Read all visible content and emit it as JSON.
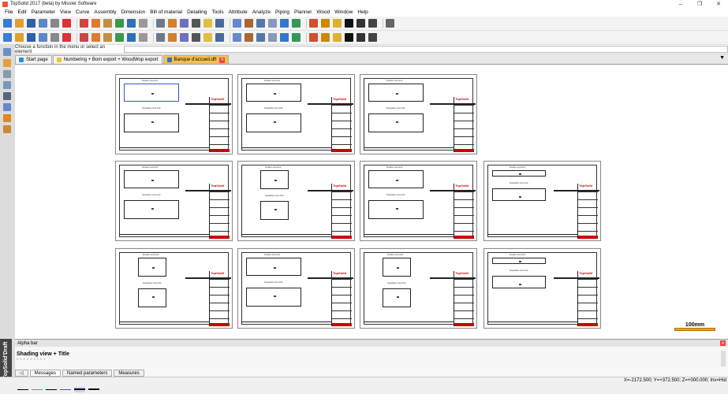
{
  "window": {
    "title": "TopSolid 2017 (beta) by Missler Software",
    "controls": [
      "–",
      "❐",
      "✕"
    ]
  },
  "menu": [
    "File",
    "Edit",
    "Parameter",
    "View",
    "Curve",
    "Assembly",
    "Dimension",
    "Bill of material",
    "Detailing",
    "Tools",
    "Attribute",
    "Analyze",
    "Piping",
    "Planner",
    "Wood",
    "Window",
    "Help"
  ],
  "toolbar1_icons": [
    "new-icon",
    "open-icon",
    "save-icon",
    "properties-icon",
    "print-icon",
    "delete-icon",
    "cut-icon",
    "erase-icon",
    "paint-icon",
    "import-icon",
    "export-icon",
    "document-icon",
    "settings-icon",
    "tool-icon",
    "measure-icon",
    "arc-icon",
    "pin-icon",
    "cursor-icon",
    "select-icon",
    "link-icon",
    "move-icon",
    "copy-icon",
    "zoom-icon",
    "fit-icon",
    "image-icon",
    "palette-icon",
    "calculator-icon",
    "color-icon",
    "dot-icon",
    "line-icon",
    "hatch-icon"
  ],
  "toolbar2_icons": [
    "view1-icon",
    "view2-icon",
    "view3-icon",
    "view4-icon",
    "view5-icon",
    "view6-icon",
    "view7-icon",
    "view8-icon",
    "view9-icon",
    "view10-icon",
    "view11-icon",
    "view12-icon",
    "view13-icon",
    "view14-icon",
    "view15-icon",
    "view16-icon",
    "view17-icon",
    "view18-icon",
    "view19-icon",
    "view20-icon",
    "view21-icon",
    "view22-icon",
    "view23-icon",
    "view24-icon",
    "view25-icon",
    "view26-icon",
    "view27-icon",
    "view28-icon",
    "view29-icon",
    "view30-icon"
  ],
  "prompt": {
    "text": "Choose a function in the menu or select an element",
    "value": ""
  },
  "tabs": [
    {
      "label": "Start page",
      "active": false,
      "closable": false,
      "color": "#2a8fd6"
    },
    {
      "label": "Numbering + Bom export + WoodWop export",
      "active": false,
      "closable": false,
      "color": "#f0c030"
    },
    {
      "label": "Banque d'accueil.dft",
      "active": true,
      "closable": true,
      "color": "#3370c0"
    }
  ],
  "tab_dropdown": "▼",
  "sheets": {
    "view_title_top": "Fixation sous tiroir",
    "view_title_bottom": "Separation sous tiroir",
    "logo": "TopSolid"
  },
  "scale": "100mm",
  "alpha_bar": {
    "title": "Alpha bar",
    "content": "Shading view + Title",
    "dash": "- - - - - - - - -",
    "tabs": [
      "Messages",
      "Named parameters",
      "Measures"
    ],
    "active_tab": "Messages",
    "nav_arrow": "◁",
    "close": "✕"
  },
  "status": {
    "coords": "X=-2172.500; Y=+372.500; Z=+000.000; Inv=Hid"
  },
  "side_label": "TopSolid'Draft",
  "colors": {
    "accent_tab": "#f5c050",
    "close_red": "#e44444",
    "scale_bar": "#f0a800",
    "title_block_red": "#cc0000"
  }
}
